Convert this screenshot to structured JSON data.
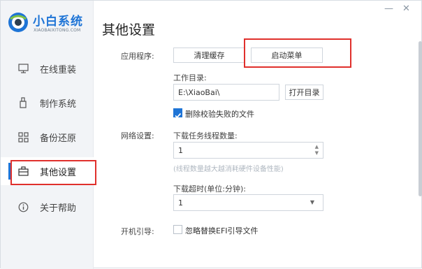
{
  "app": {
    "logo_title": "小白系统",
    "logo_subtitle": "XIAOBAIXITONG.COM",
    "brand_color": "#1e74d6",
    "highlight_color": "#e0302c"
  },
  "window_controls": {
    "minimize_icon": "minimize-icon",
    "close_icon": "close-icon"
  },
  "sidebar": {
    "items": [
      {
        "label": "在线重装",
        "icon": "monitor-icon"
      },
      {
        "label": "制作系统",
        "icon": "usb-drive-icon"
      },
      {
        "label": "备份还原",
        "icon": "backup-grid-icon"
      },
      {
        "label": "其他设置",
        "icon": "briefcase-icon",
        "active": true
      },
      {
        "label": "关于帮助",
        "icon": "info-icon"
      }
    ]
  },
  "main": {
    "title": "其他设置",
    "app_section": {
      "label": "应用程序:",
      "clear_cache_btn": "清理缓存",
      "startup_menu_btn": "启动菜单",
      "workdir_label": "工作目录:",
      "workdir_value": "E:\\XiaoBai\\",
      "open_dir_btn": "打开目录",
      "delete_failed_checked": true,
      "delete_failed_label": "删除校验失败的文件"
    },
    "network_section": {
      "label": "网络设置:",
      "thread_count_label": "下载任务线程数量:",
      "thread_count_value": "1",
      "thread_hint": "(线程数量越大越消耗硬件设备性能)",
      "timeout_label": "下载超时(单位:分钟):",
      "timeout_value": "1"
    },
    "boot_section": {
      "label": "开机引导:",
      "ignore_efi_checked": false,
      "ignore_efi_label": "忽略替换EFI引导文件"
    }
  }
}
